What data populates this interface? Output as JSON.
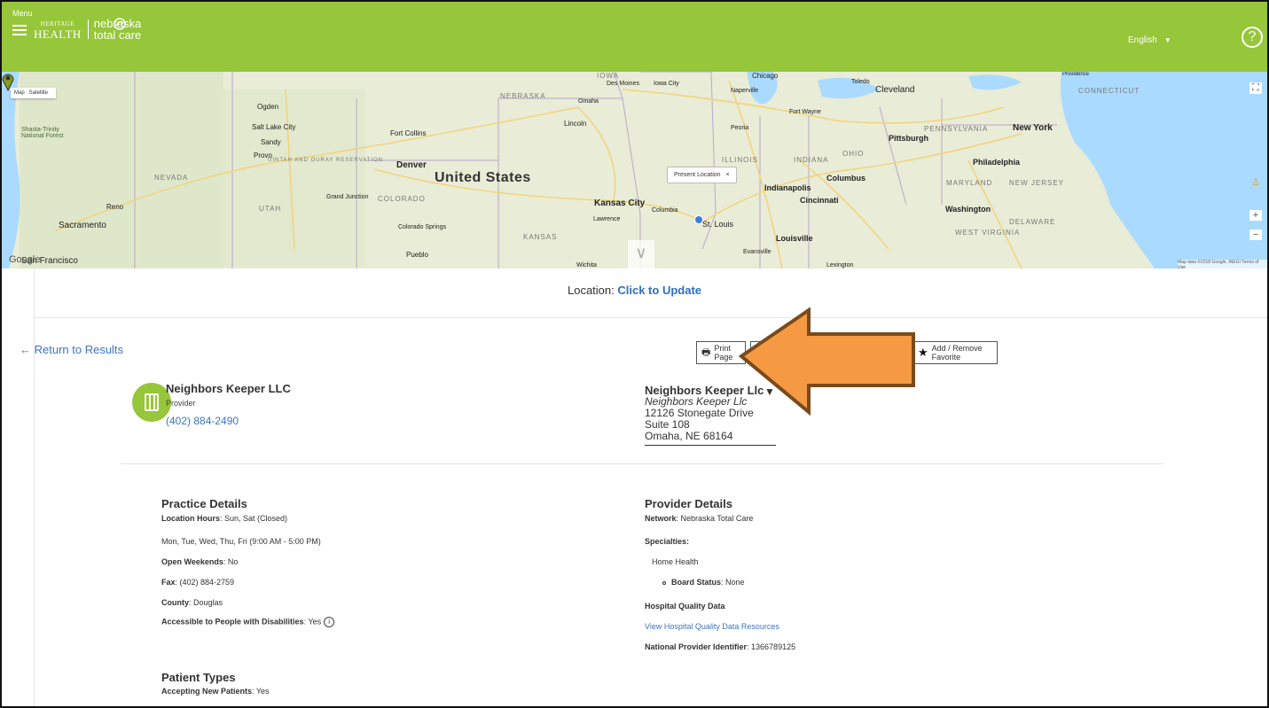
{
  "header": {
    "menu_label": "Menu",
    "logo_left_top": "HERITAGE",
    "logo_left_bottom": "HEALTH",
    "logo_right_top": "nebraska",
    "logo_right_bottom": "total care",
    "language": "English",
    "help": "?"
  },
  "map": {
    "type_map": "Map",
    "type_satellite": "Satellite",
    "country": "United States",
    "states": [
      "NEBRASKA",
      "NEVADA",
      "UTAH",
      "COLORADO",
      "KANSAS",
      "ILLINOIS",
      "INDIANA",
      "OHIO",
      "PENNSYLVANIA",
      "MARYLAND",
      "NEW JERSEY",
      "DELAWARE",
      "WEST VIRGINIA",
      "CONNECTICUT",
      "IOWA"
    ],
    "cities": [
      "Sacramento",
      "San Francisco",
      "Reno",
      "Ogden",
      "Salt Lake City",
      "Provo",
      "Sandy",
      "Denver",
      "Fort Collins",
      "Colorado Springs",
      "Pueblo",
      "Grand Junction",
      "Omaha",
      "Lincoln",
      "Des Moines",
      "Iowa City",
      "Kansas City",
      "Columbia",
      "Lawrence",
      "St. Louis",
      "Chicago",
      "Naperville",
      "Peoria",
      "Fort Wayne",
      "Toledo",
      "Cleveland",
      "Indianapolis",
      "Cincinnati",
      "Columbus",
      "Louisville",
      "Evansville",
      "Pittsburgh",
      "Philadelphia",
      "New York",
      "Washington",
      "Providence",
      "Shasta-Trinity National Forest",
      "UINTAH AND OURAY RESERVATION",
      "Wichita",
      "Lexington"
    ],
    "popup": "Present Location",
    "popup_close": "×",
    "google": "Google",
    "credit": "Map data ©2018 Google, INEGI  Terms of Use",
    "chevron": "∨"
  },
  "location": {
    "label": "Location:",
    "link": "Click to Update"
  },
  "nav": {
    "return": "← Return to Results"
  },
  "actions": {
    "print": "Print Page",
    "favorite": "Add / Remove Favorite"
  },
  "provider": {
    "name": "Neighbors Keeper LLC",
    "type": "Provider",
    "phone": "(402) 884-2490"
  },
  "address": {
    "name": "Neighbors Keeper Llc",
    "subname": "Neighbors Keeper Llc",
    "street": "12126 Stonegate Drive Suite 108",
    "city": "Omaha, NE 68164"
  },
  "practice": {
    "title": "Practice Details",
    "hours_label": "Location Hours",
    "hours_value": ": Sun, Sat (Closed)",
    "hours_line2": "Mon, Tue, Wed, Thu, Fri (9:00 AM - 5:00 PM)",
    "weekends_label": "Open Weekends",
    "weekends_value": ": No",
    "fax_label": "Fax",
    "fax_value": ": (402) 884-2759",
    "county_label": "County",
    "county_value": ": Douglas",
    "access_label": "Accessible to People with Disabilities",
    "access_value": ": Yes",
    "info": "i"
  },
  "patient": {
    "title": "Patient Types",
    "accepting_label": "Accepting New Patients",
    "accepting_value": ": Yes"
  },
  "provider_details": {
    "title": "Provider Details",
    "network_label": "Network",
    "network_value": ": Nebraska Total Care",
    "specialties_label": "Specialties",
    "specialties_colon": ":",
    "specialty": "Home Health",
    "board_label": "Board Status",
    "board_value": ": None",
    "hq_label": "Hospital Quality Data",
    "hq_link": "View Hospital Quality Data Resources",
    "npi_label": "National Provider Identifier",
    "npi_value": ": 1366789125"
  },
  "colors": {
    "brand_green": "#96c63a",
    "link_blue": "#3d75c0",
    "arrow_orange": "#f59a42"
  }
}
